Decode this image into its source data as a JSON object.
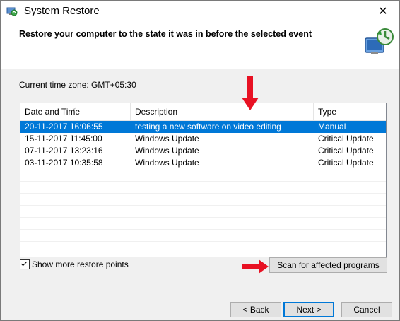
{
  "window": {
    "title": "System Restore",
    "close_glyph": "✕",
    "title_icon": "system-restore-icon"
  },
  "header": {
    "instruction": "Restore your computer to the state it was in before the selected event",
    "hero_icon": "system-restore-hero-icon"
  },
  "timezone": "Current time zone: GMT+05:30",
  "table": {
    "columns": [
      "Date and Time",
      "Description",
      "Type"
    ],
    "rows": [
      {
        "datetime": "20-11-2017 16:06:55",
        "description": "testing a new software on video editing",
        "type": "Manual",
        "selected": true
      },
      {
        "datetime": "15-11-2017 11:45:00",
        "description": "Windows Update",
        "type": "Critical Update",
        "selected": false
      },
      {
        "datetime": "07-11-2017 13:23:16",
        "description": "Windows Update",
        "type": "Critical Update",
        "selected": false
      },
      {
        "datetime": "03-11-2017 10:35:58",
        "description": "Windows Update",
        "type": "Critical Update",
        "selected": false
      }
    ]
  },
  "show_more": {
    "label": "Show more restore points",
    "checked": true
  },
  "buttons": {
    "scan": "Scan for affected programs",
    "back": "< Back",
    "next": "Next >",
    "cancel": "Cancel"
  },
  "colors": {
    "selection": "#0078d7",
    "annotation_arrow": "#e81123"
  }
}
